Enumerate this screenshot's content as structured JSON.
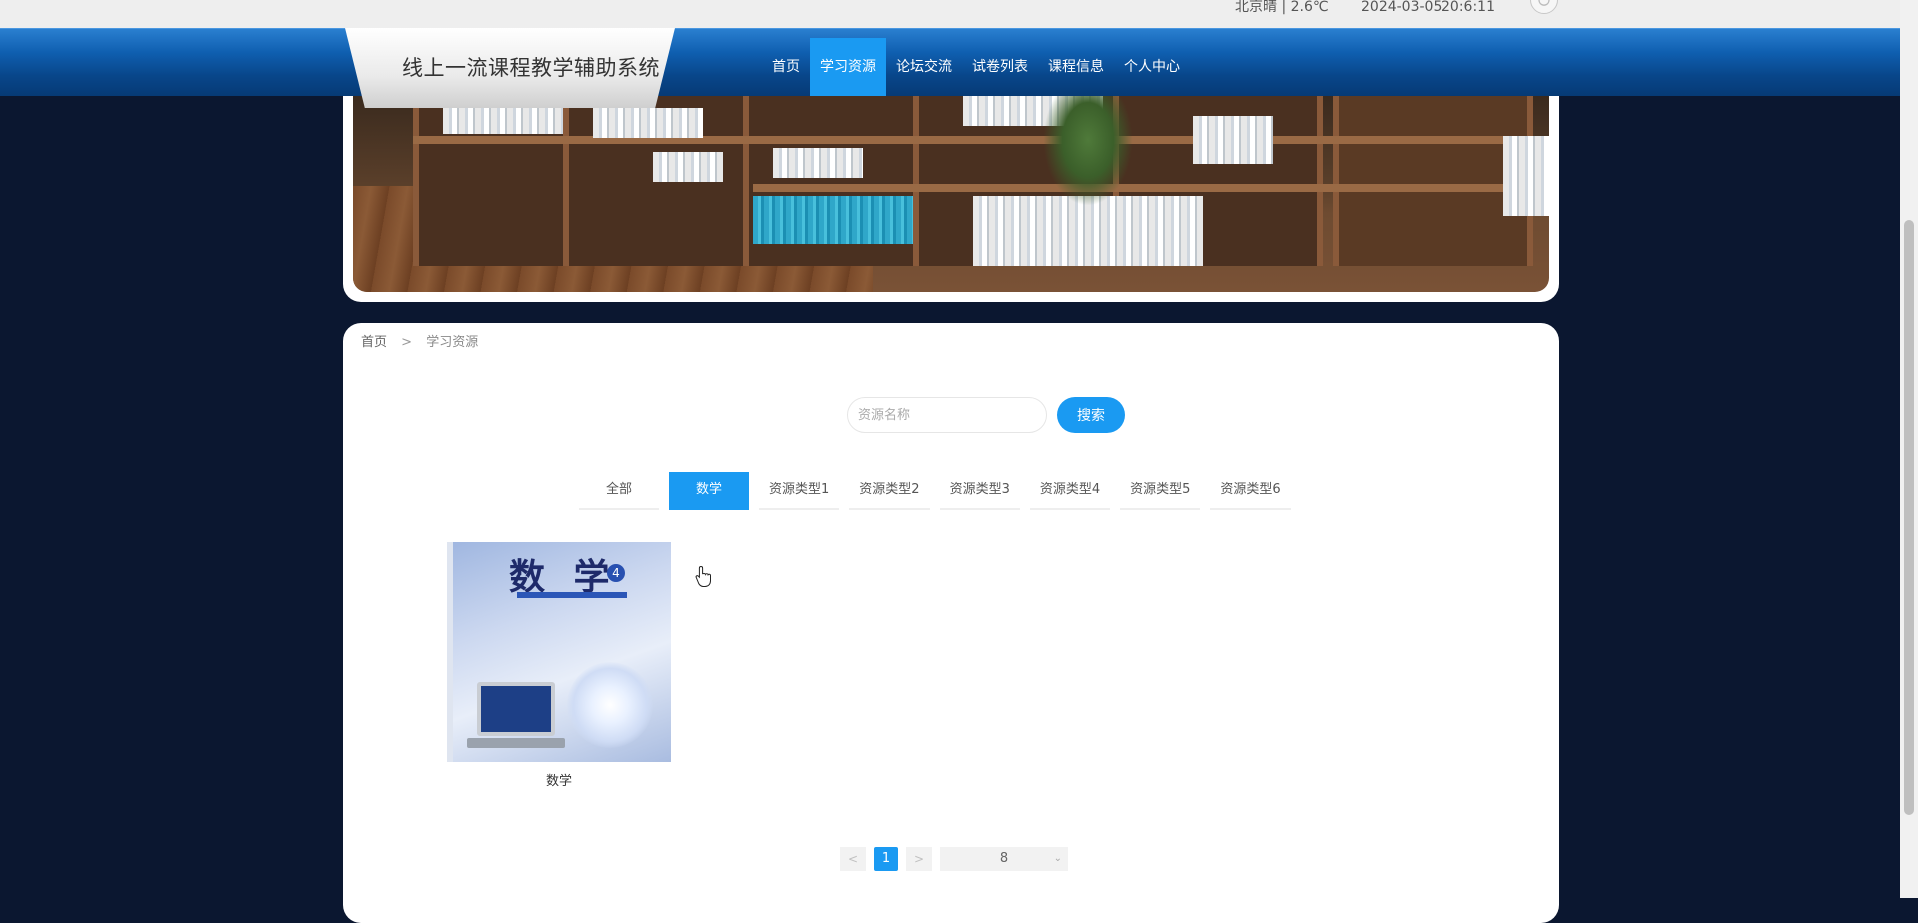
{
  "topbar": {
    "weather": "北京晴 | 2.6℃",
    "date": "2024-03-05",
    "time": "20:6:11",
    "power_icon": "power-icon"
  },
  "header": {
    "site_title": "线上一流课程教学辅助系统",
    "nav": [
      {
        "label": "首页"
      },
      {
        "label": "学习资源",
        "active": true
      },
      {
        "label": "论坛交流"
      },
      {
        "label": "试卷列表"
      },
      {
        "label": "课程信息"
      },
      {
        "label": "个人中心"
      }
    ]
  },
  "breadcrumb": {
    "home": "首页",
    "separator": ">",
    "current": "学习资源"
  },
  "search": {
    "placeholder": "资源名称",
    "value": "",
    "button_label": "搜索"
  },
  "category_tabs": [
    {
      "label": "全部"
    },
    {
      "label": "数学",
      "active": true
    },
    {
      "label": "资源类型1"
    },
    {
      "label": "资源类型2"
    },
    {
      "label": "资源类型3"
    },
    {
      "label": "资源类型4"
    },
    {
      "label": "资源类型5"
    },
    {
      "label": "资源类型6"
    }
  ],
  "resources": [
    {
      "name": "数学",
      "cover_title": "数 学",
      "cover_number": "4"
    }
  ],
  "pagination": {
    "prev": "<",
    "next": ">",
    "current_page": "1",
    "page_size": "8"
  },
  "colors": {
    "accent": "#1a9af2",
    "nav_dark": "#08468a",
    "background": "#0b1730"
  }
}
